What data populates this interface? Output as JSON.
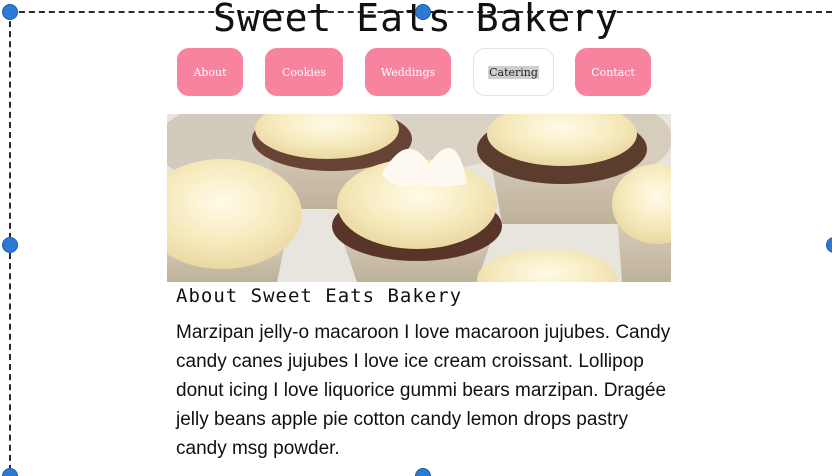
{
  "site": {
    "title": "Sweet Eats Bakery"
  },
  "nav": {
    "items": [
      {
        "label": "About"
      },
      {
        "label": "Cookies"
      },
      {
        "label": "Weddings"
      },
      {
        "label": "Catering"
      },
      {
        "label": "Contact"
      }
    ],
    "active": "Catering"
  },
  "hero": {
    "icon": "cupcakes-photo"
  },
  "about": {
    "heading": "About Sweet Eats Bakery",
    "body": "Marzipan jelly-o macaroon I love macaroon jujubes. Candy candy canes jujubes I love ice cream croissant. Lollipop donut icing I love liquorice gummi bears marzipan. Dragée jelly beans apple pie cotton candy lemon drops pastry candy msg powder."
  },
  "colors": {
    "nav_button": "#f7839f",
    "selection_handle": "#2c7ad6"
  }
}
